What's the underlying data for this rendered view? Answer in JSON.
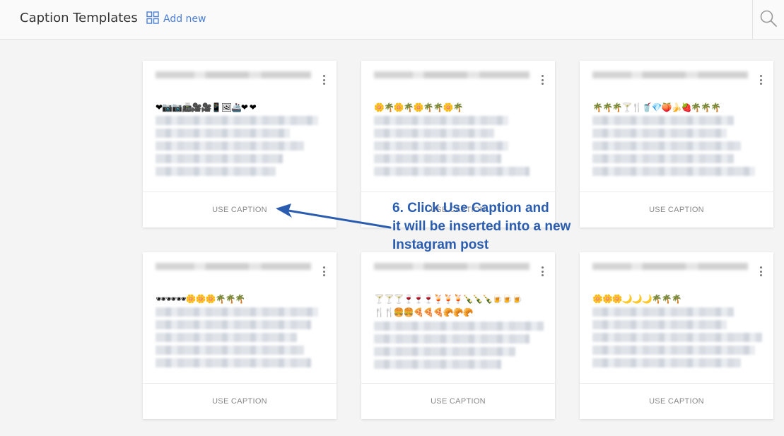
{
  "header": {
    "title": "Caption Templates",
    "add_new_label": "Add new"
  },
  "cards": [
    {
      "emojis": "❤📷📷📠🎥🎥📱🖼🚢❤ ❤",
      "emojis2": "",
      "action": "USE CAPTION"
    },
    {
      "emojis": "🌼🌴🌼🌴🌼🌴🌴🌼🌴",
      "emojis2": "",
      "action": "USE CAPTION"
    },
    {
      "emojis": "🌴🌴🌴🍸🍴🥤💎🍑🍌🍓🌴🌴🌴",
      "emojis2": "",
      "action": "USE CAPTION"
    },
    {
      "emojis": "🕶🕶🕶🌼🌼🌼🌴🌴🌴",
      "emojis2": "",
      "action": "USE CAPTION"
    },
    {
      "emojis": "🍸🍸🍸🍷🍷🍷🍹🍹🍹🍾🍾🍾🍺🍺🍺",
      "emojis2": "🍴🍴🍔🍔🍕🍕🍕🥐🥐🥐",
      "action": "USE CAPTION"
    },
    {
      "emojis": "🌼🌼🌼🌙🌙🌙🌴🌴🌴",
      "emojis2": "",
      "action": "USE CAPTION"
    }
  ],
  "annotation": {
    "line1": "6. Click Use Caption and",
    "line2": "it will be inserted into a new",
    "line3": "Instagram post"
  },
  "colors": {
    "accent": "#4a7fd8",
    "annotation": "#2a5db0"
  }
}
